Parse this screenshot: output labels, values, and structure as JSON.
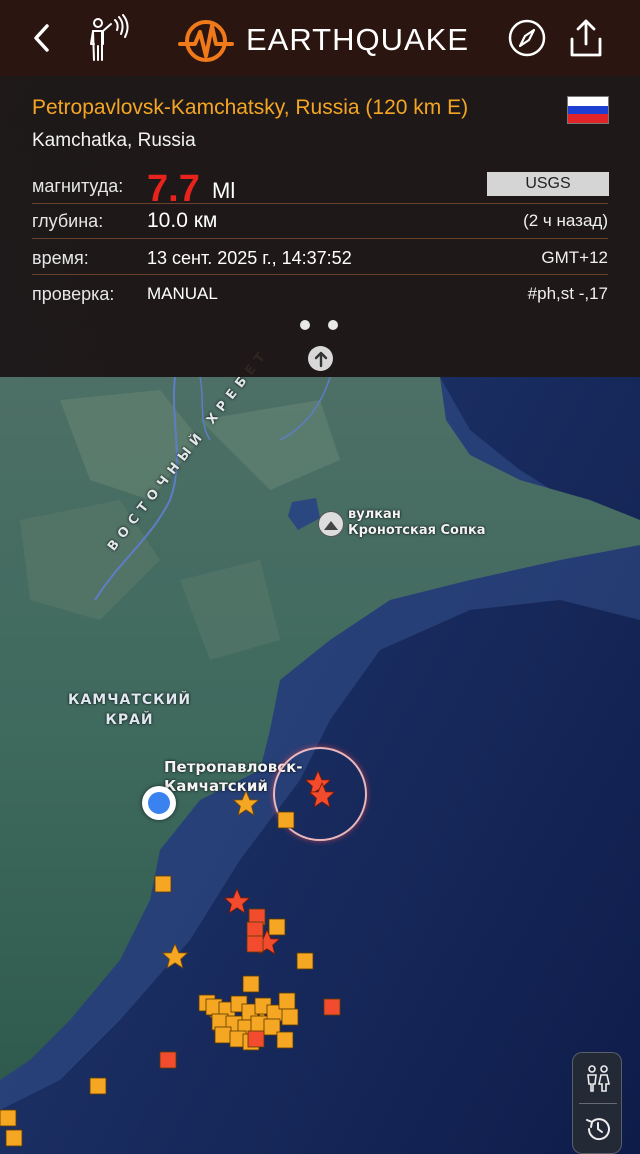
{
  "header": {
    "title": "EARTHQUAKE",
    "back_icon": "chevron-left-icon",
    "felt_report_icon": "person-waving-icon",
    "compass_icon": "compass-icon",
    "share_icon": "share-icon"
  },
  "event": {
    "place": "Petropavlovsk-Kamchatsky, Russia (120 km E)",
    "region": "Kamchatka, Russia",
    "magnitude_label": "магнитуда:",
    "magnitude_value": "7.7",
    "magnitude_type": "Ml",
    "source": "USGS",
    "depth_label": "глубина:",
    "depth_value": "10.0 км",
    "relative_time": "(2 ч назад)",
    "time_label": "время:",
    "time_value": "13 сент. 2025 г., 14:37:52",
    "timezone": "GMT+12",
    "review_label": "проверка:",
    "review_value": "MANUAL",
    "review_code": "#ph,st -,17",
    "flag_colors": [
      "#ffffff",
      "#1c3fd1",
      "#e0242a"
    ]
  },
  "pager": {
    "pages": 2,
    "current": 1
  },
  "map": {
    "region_label_line1": "КАМЧАТСКИЙ",
    "region_label_line2": "КРАЙ",
    "ridge_label": "ВОСТОЧНЫЙ ХРЕБЕТ",
    "volcano_line1": "вулкан",
    "volcano_line2": "Кронотская Сопка",
    "city_line1": "Петропавловск-",
    "city_line2": "Камчатский"
  },
  "controls": {
    "people_icon": "people-icon",
    "history_icon": "history-icon"
  },
  "colors": {
    "header_bg": "#2a1510",
    "accent_orange": "#f4a623",
    "magnitude_red": "#e8231d",
    "marker_orange": "#f5a623",
    "marker_red": "#f24b2e"
  }
}
